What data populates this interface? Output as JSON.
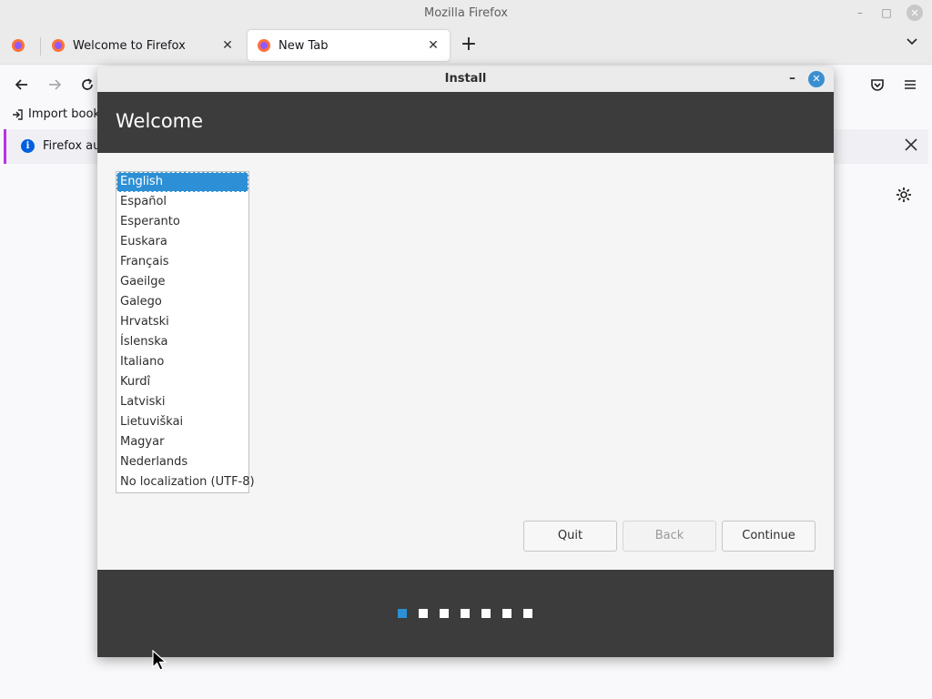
{
  "window": {
    "title": "Mozilla Firefox"
  },
  "tabs": [
    {
      "label": "Welcome to Firefox",
      "active": false
    },
    {
      "label": "New Tab",
      "active": true
    }
  ],
  "bookmarks": {
    "import_label": "Import book"
  },
  "notification": {
    "text": "Firefox au"
  },
  "dialog": {
    "title": "Install",
    "header_title": "Welcome",
    "languages": [
      "English",
      "Español",
      "Esperanto",
      "Euskara",
      "Français",
      "Gaeilge",
      "Galego",
      "Hrvatski",
      "Íslenska",
      "Italiano",
      "Kurdî",
      "Latviski",
      "Lietuviškai",
      "Magyar",
      "Nederlands",
      "No localization (UTF-8)"
    ],
    "selected_language": "English",
    "buttons": {
      "quit": "Quit",
      "back": "Back",
      "continue": "Continue"
    },
    "progress": {
      "total_steps": 7,
      "current_step": 1
    }
  },
  "colors": {
    "accent": "#2d8fd5",
    "header_bg": "#3c3c3c",
    "notification_bar": "#b833e1"
  }
}
